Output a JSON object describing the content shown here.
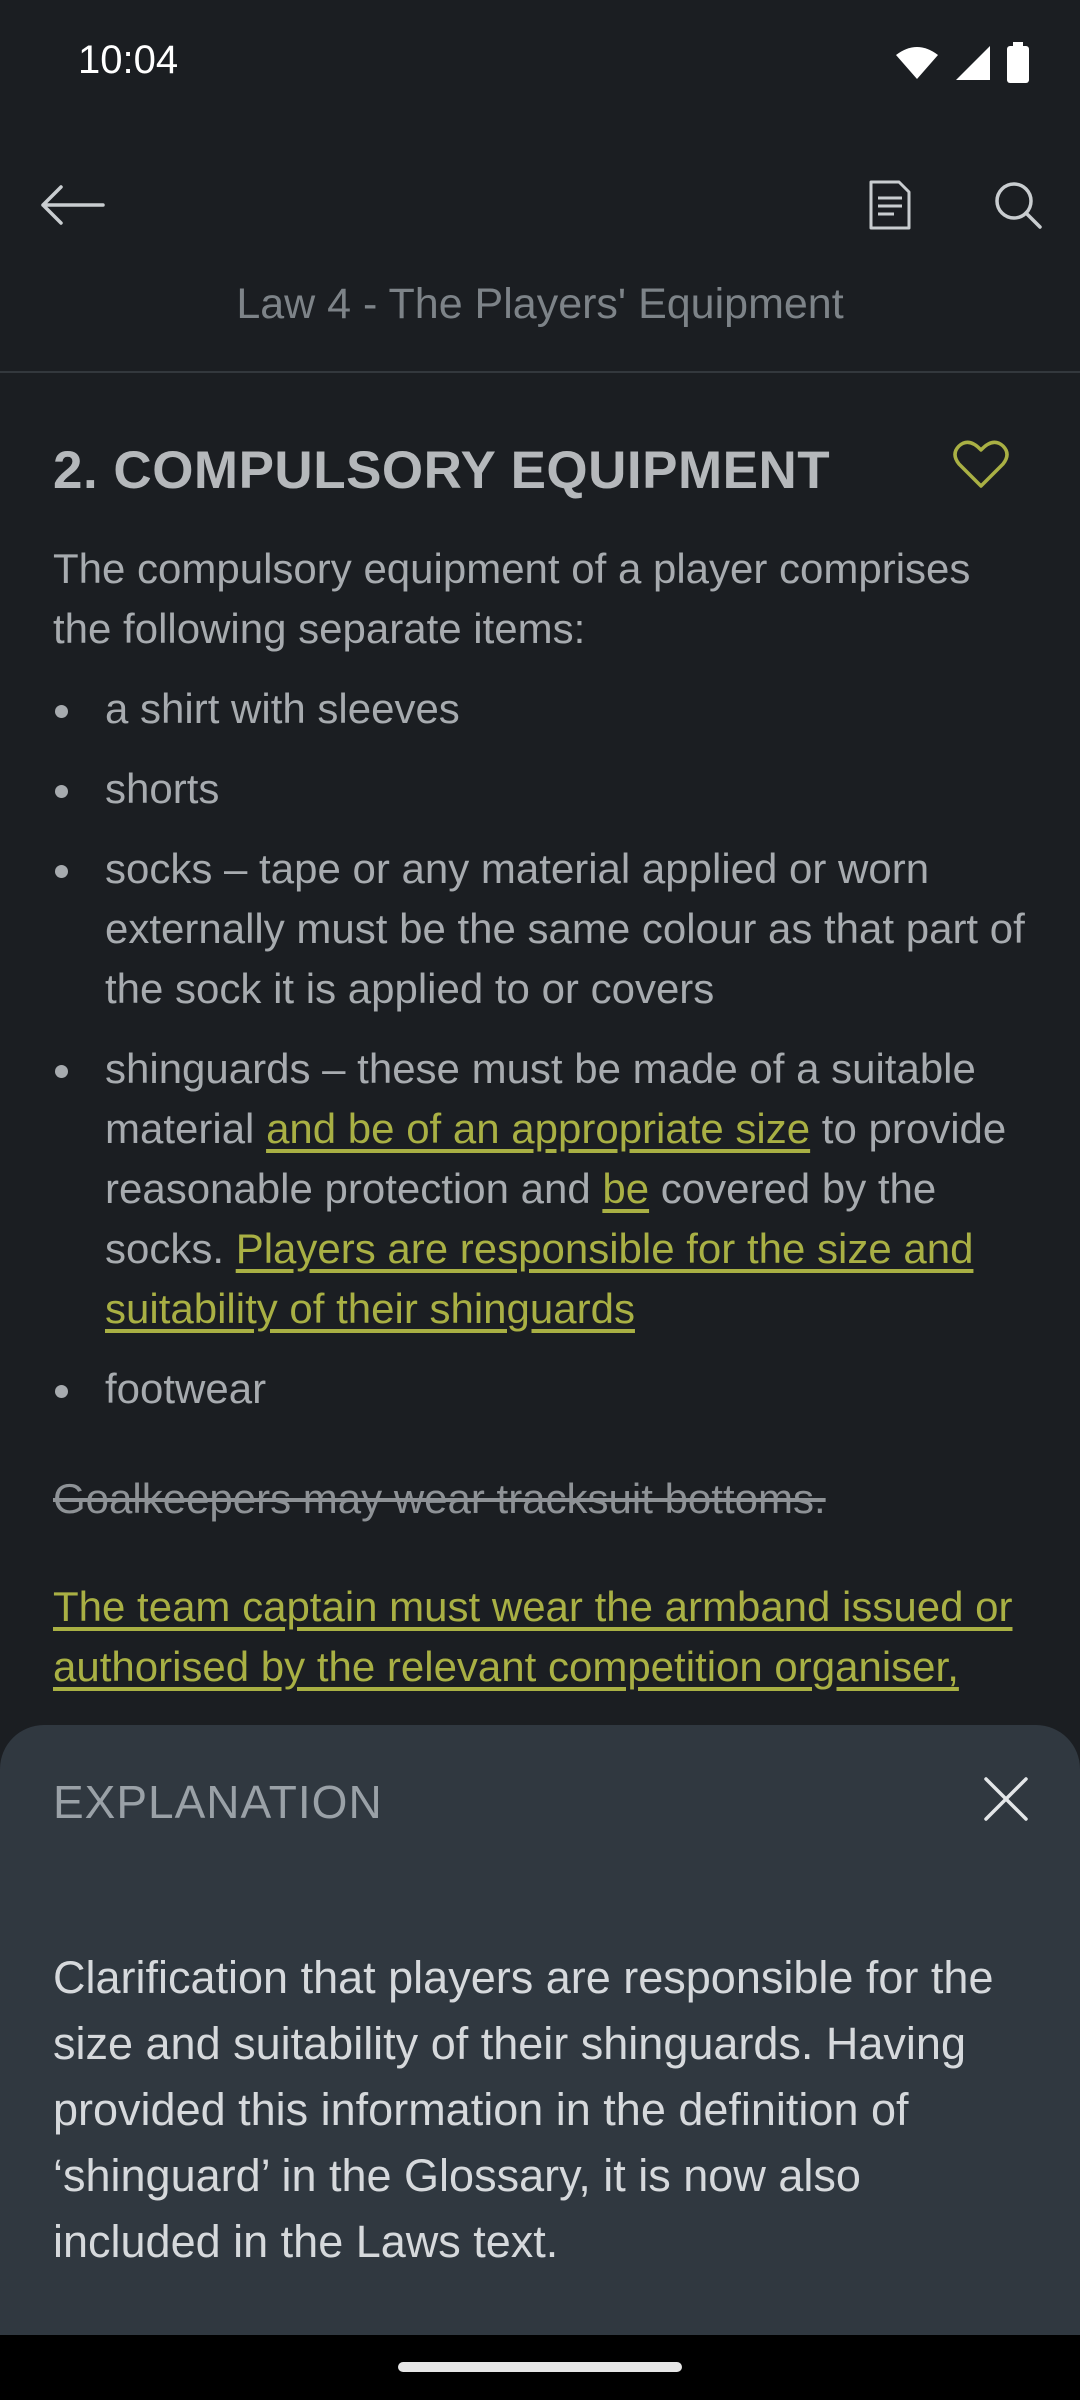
{
  "status_bar": {
    "time": "10:04"
  },
  "toolbar": {
    "back_icon": "arrow-left-icon",
    "document_icon": "document-icon",
    "search_icon": "search-icon"
  },
  "page_title": "Law 4 - The Players' Equipment",
  "section": {
    "title": "2. COMPULSORY EQUIPMENT",
    "intro": "The compulsory equipment of a player comprises the following separate items:",
    "items": [
      "a shirt with sleeves",
      "shorts",
      "socks – tape or any material applied or worn externally must be the same colour as that part of the sock it is applied to or covers"
    ],
    "shinguards": {
      "part1": "shinguards – these must be made of a suitable material ",
      "added1": "and be of an appropriate size",
      "part2": " to provide reasonable protection and ",
      "added2": "be",
      "part3": " covered by the socks. ",
      "added3": "Players are responsible for the size and suitability of their shinguards"
    },
    "footwear": "footwear",
    "struck_text": "Goalkeepers may wear tracksuit bottoms.",
    "captain_text": "The team captain must wear the armband issued or authorised by the relevant competition organiser,"
  },
  "explanation": {
    "title": "EXPLANATION",
    "body": "Clarification that players are responsible for the size and suitability of their shinguards. Having provided this information in the definition of ‘shinguard’ in the Glossary, it is now also included in the Laws text."
  },
  "colors": {
    "background": "#1b1e22",
    "sheet": "#303840",
    "added_text": "#a9b044"
  }
}
